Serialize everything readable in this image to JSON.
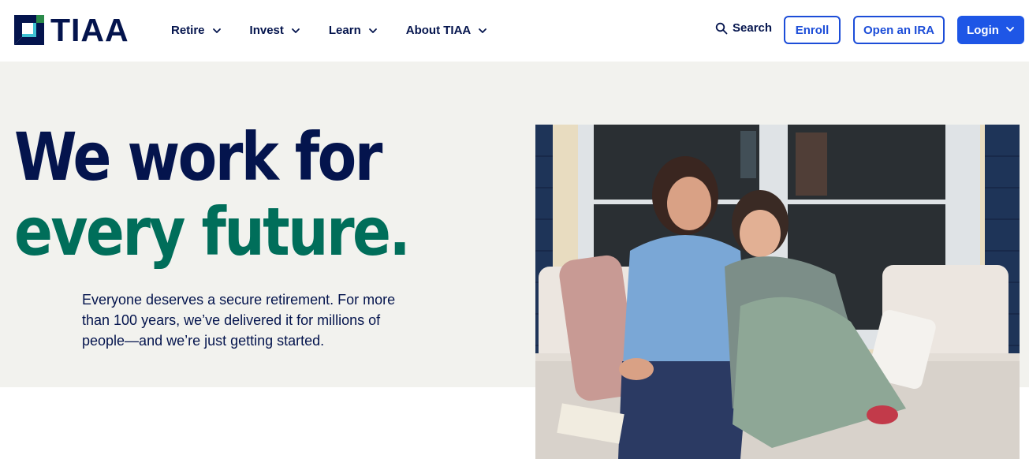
{
  "brand": {
    "name": "TIAA",
    "logo_icon": "tiaa-logo-mark-icon"
  },
  "nav": {
    "items": [
      {
        "label": "Retire"
      },
      {
        "label": "Invest"
      },
      {
        "label": "Learn"
      },
      {
        "label": "About TIAA"
      }
    ]
  },
  "actions": {
    "search_label": "Search",
    "enroll_label": "Enroll",
    "ira_label": "Open an IRA",
    "login_label": "Login"
  },
  "hero": {
    "headline_line1": "We work for",
    "headline_line2": "every future.",
    "lede": "Everyone deserves a secure retirement. For more than 100 years, we’ve delivered it for millions of people—and we’re just getting started."
  },
  "colors": {
    "navy": "#04144d",
    "green": "#006e5a",
    "blue": "#1e56e6",
    "hero_bg": "#f2f2ee"
  }
}
